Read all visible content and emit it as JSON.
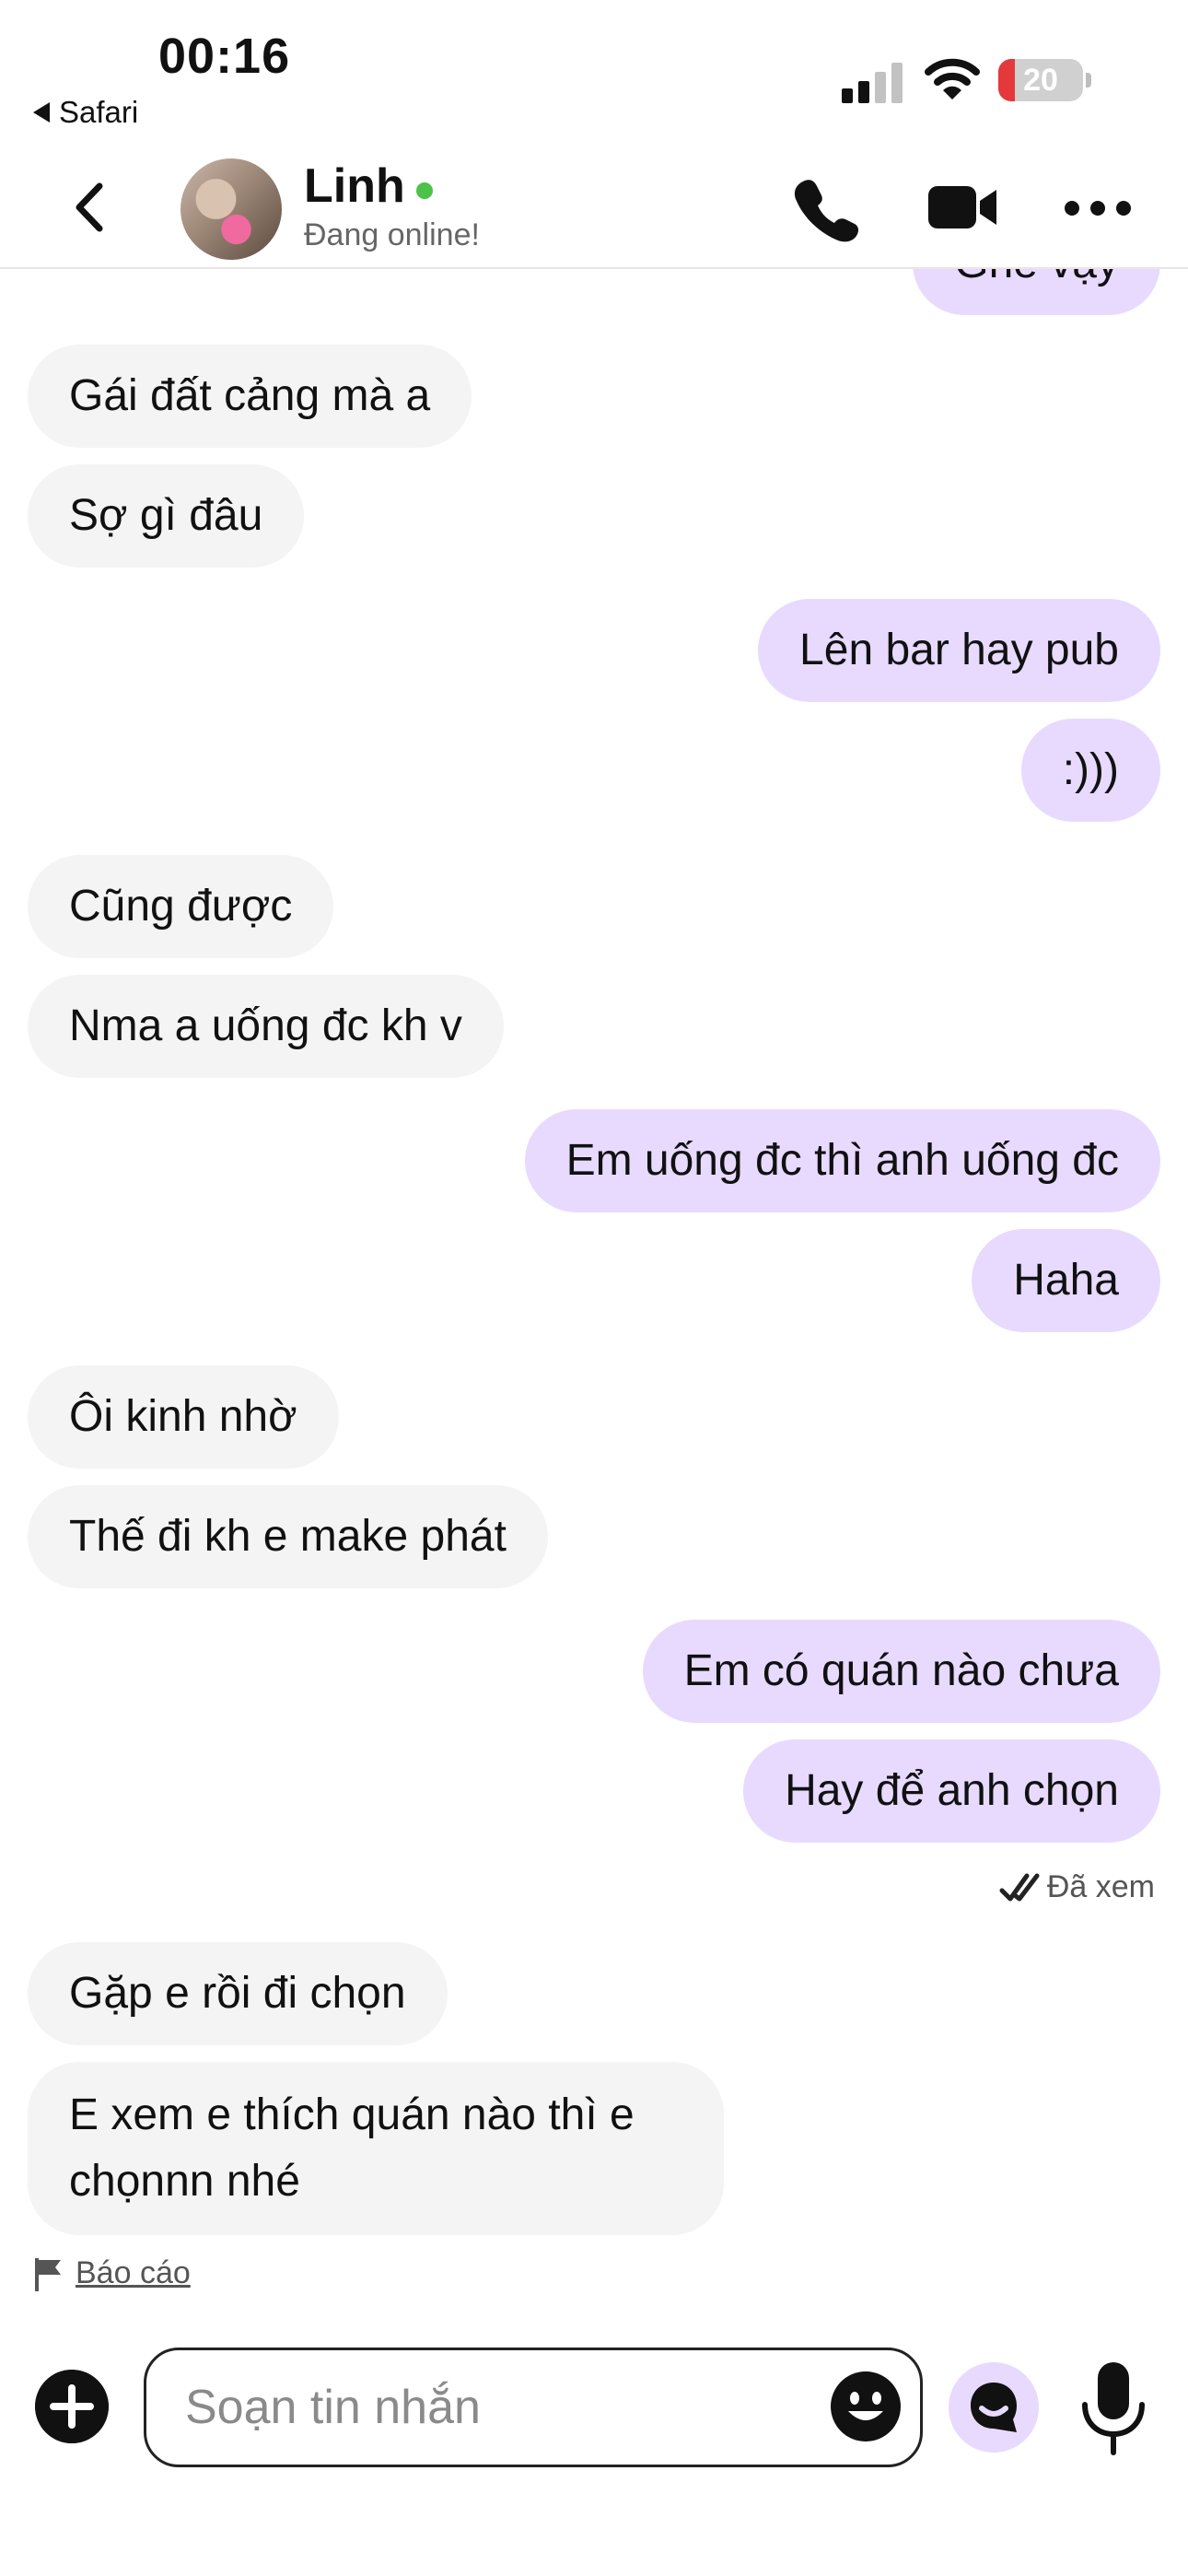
{
  "status_bar": {
    "time": "00:16",
    "back_app": "Safari",
    "battery": "20",
    "battery_level": 0.2
  },
  "header": {
    "name": "Linh",
    "status": "Đang online!"
  },
  "messages": [
    {
      "from": "me",
      "text": "Ghé vậy"
    },
    {
      "from": "them",
      "text": "Gái đất cảng mà a"
    },
    {
      "from": "them",
      "text": "Sợ gì đâu"
    },
    {
      "from": "me",
      "text": "Lên bar hay pub"
    },
    {
      "from": "me",
      "text": ":)))"
    },
    {
      "from": "them",
      "text": "Cũng được"
    },
    {
      "from": "them",
      "text": "Nma a uống đc kh v"
    },
    {
      "from": "me",
      "text": "Em uống đc thì anh uống đc"
    },
    {
      "from": "me",
      "text": "Haha"
    },
    {
      "from": "them",
      "text": "Ôi kinh nhờ"
    },
    {
      "from": "them",
      "text": "Thế đi kh e make phát"
    },
    {
      "from": "me",
      "text": "Em có quán nào chưa"
    },
    {
      "from": "me",
      "text": "Hay để anh chọn"
    },
    {
      "from": "them",
      "text": "Gặp e rồi đi chọn"
    },
    {
      "from": "them",
      "text": "E xem e thích quán nào thì e chọnnn nhé"
    }
  ],
  "seen_label": "Đã xem",
  "report_label": "Báo cáo",
  "composer": {
    "placeholder": "Soạn tin nhắn"
  },
  "colors": {
    "outgoing_bubble": "#e8daff",
    "incoming_bubble": "#f4f4f4",
    "online": "#4cc24a",
    "battery_low": "#e5383b"
  },
  "icons": [
    "back-icon",
    "phone-icon",
    "video-camera-icon",
    "more-icon",
    "double-check-icon",
    "flag-icon",
    "plus-icon",
    "emoji-icon",
    "ai-chat-icon",
    "microphone-icon"
  ]
}
